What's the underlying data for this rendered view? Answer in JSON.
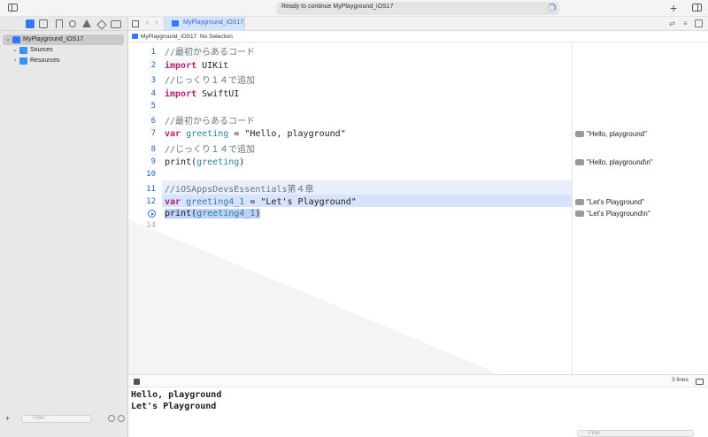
{
  "window": {
    "activity_status": "Ready to continue MyPlayground_iOS17"
  },
  "navigator": {
    "items": [
      {
        "label": "MyPlayground_iOS17",
        "icon": "swift-file-icon",
        "expanded": true
      },
      {
        "label": "Sources",
        "icon": "folder-icon",
        "expanded": true
      },
      {
        "label": "Resources",
        "icon": "folder-icon",
        "expanded": false
      }
    ],
    "filter_placeholder": "Filter"
  },
  "editor": {
    "tab_label": "MyPlayground_iOS17",
    "jumpbar": {
      "project": "MyPlayground_iOS17",
      "selection": "No Selection"
    },
    "lines": [
      {
        "n": "1",
        "text": "//最初からあるコード"
      },
      {
        "n": "2",
        "text": "import UIKit"
      },
      {
        "n": "3",
        "text": "//じっくり１４で追加"
      },
      {
        "n": "4",
        "text": "import SwiftUI"
      },
      {
        "n": "5",
        "text": ""
      },
      {
        "n": "6",
        "text": "//最初からあるコード"
      },
      {
        "n": "7",
        "text": "var greeting = \"Hello, playground\""
      },
      {
        "n": "8",
        "text": "//じっくり１４で追加"
      },
      {
        "n": "9",
        "text": "print(greeting)"
      },
      {
        "n": "10",
        "text": ""
      },
      {
        "n": "11",
        "text": "//iOSAppsDevsEssentials第４章"
      },
      {
        "n": "12",
        "text": "var greeting4_1 = \"Let's Playground\""
      },
      {
        "n": "13",
        "text": "print(greeting4_1)"
      },
      {
        "n": "14",
        "text": ""
      }
    ],
    "code": {
      "l1_comment": "//最初からあるコード",
      "l2_kw": "import",
      "l2_rest": " UIKit",
      "l3_comment": "//じっくり１４で追加",
      "l4_kw": "import",
      "l4_rest": " SwiftUI",
      "l6_comment": "//最初からあるコード",
      "l7_kw": "var",
      "l7_id": "greeting",
      "l7_eq": " = ",
      "l7_str": "\"Hello, playground\"",
      "l8_comment": "//じっくり１４で追加",
      "l9_fn": "print(",
      "l9_id": "greeting",
      "l9_close": ")",
      "l11_comment": "//iOSAppsDevsEssentials第４章",
      "l12_kw": "var",
      "l12_id": "greeting4_1",
      "l12_eq": " = ",
      "l12_str": "\"Let's Playground\"",
      "l13_fn": "print(",
      "l13_id": "greeting4_1",
      "l13_close": ")"
    }
  },
  "results": {
    "r7": "\"Hello, playground\"",
    "r9": "\"Hello, playground\\n\"",
    "r12": "\"Let's Playground\"",
    "r13": "\"Let's Playground\\n\""
  },
  "debug": {
    "line_count": "3 lines",
    "console": [
      "Hello, playground",
      "Let's Playground"
    ],
    "filter_placeholder": "Filter"
  },
  "colors": {
    "accent": "#3478f6",
    "keyword": "#b5217a",
    "identifier": "#2b80a5",
    "comment": "#6c7680",
    "line_number": "#1f5fd0",
    "selection_band": "#d7e3fb"
  }
}
